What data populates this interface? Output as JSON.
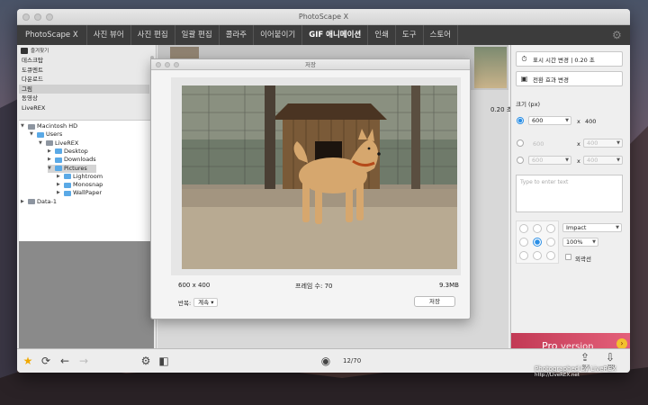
{
  "window": {
    "title": "PhotoScape X"
  },
  "menu": {
    "items": [
      "PhotoScape X",
      "사진 뷰어",
      "사진 편집",
      "일괄 편집",
      "콜라주",
      "이어붙이기",
      "GIF 애니메이션",
      "인쇄",
      "도구",
      "스토어"
    ],
    "active": "GIF 애니메이션"
  },
  "sidebar": {
    "favorites_label": "즐겨찾기",
    "favorites": [
      "데스크탑",
      "도큐멘트",
      "다운로드",
      "그림",
      "동영상",
      "LiveREX"
    ],
    "selected_favorite": "그림",
    "tree": [
      {
        "label": "Macintosh HD",
        "indent": 0,
        "expanded": true
      },
      {
        "label": "Users",
        "indent": 1,
        "expanded": true
      },
      {
        "label": "LiveREX",
        "indent": 2,
        "expanded": true
      },
      {
        "label": "Desktop",
        "indent": 3,
        "expanded": false
      },
      {
        "label": "Downloads",
        "indent": 3,
        "expanded": false
      },
      {
        "label": "Pictures",
        "indent": 3,
        "expanded": true,
        "selected": true
      },
      {
        "label": "Lightroom",
        "indent": 4,
        "expanded": false
      },
      {
        "label": "Monosnap",
        "indent": 4,
        "expanded": false
      },
      {
        "label": "WallPaper",
        "indent": 4,
        "expanded": false
      },
      {
        "label": "Data-1",
        "indent": 0,
        "expanded": false
      }
    ]
  },
  "dialog": {
    "title": "저장",
    "size_text": "600 x 400",
    "frames_text": "프레임 수: 70",
    "filesize_text": "9.3MB",
    "repeat_label": "반복:",
    "repeat_value": "계속",
    "save_label": "저장"
  },
  "timeline": {
    "duration_text": "0.20 초",
    "counter": "12/70"
  },
  "right_panel": {
    "display_time_button": "표시 시간 변경 | 0.20 초",
    "transition_button": "전환 효과 변경",
    "size_label": "크기 (px)",
    "width": "600",
    "height": "400",
    "row2_w": "600",
    "row2_h": "400",
    "row3_w": "600",
    "row3_h": "400",
    "x_label": "x",
    "text_placeholder": "Type to enter text",
    "font": "Impact",
    "zoom": "100%",
    "outline_label": "외곽선",
    "promo_pro": "Pro",
    "promo_version": "version"
  },
  "bottom": {
    "open_label": "열기",
    "save_label": "저장"
  },
  "watermark": {
    "line1": "Photographed by LiveREX",
    "line2": "http://LiveREX.net"
  },
  "colors": {
    "accent": "#2a8fe6",
    "menubar": "#3c3c3c",
    "promo": "#d24b67"
  }
}
